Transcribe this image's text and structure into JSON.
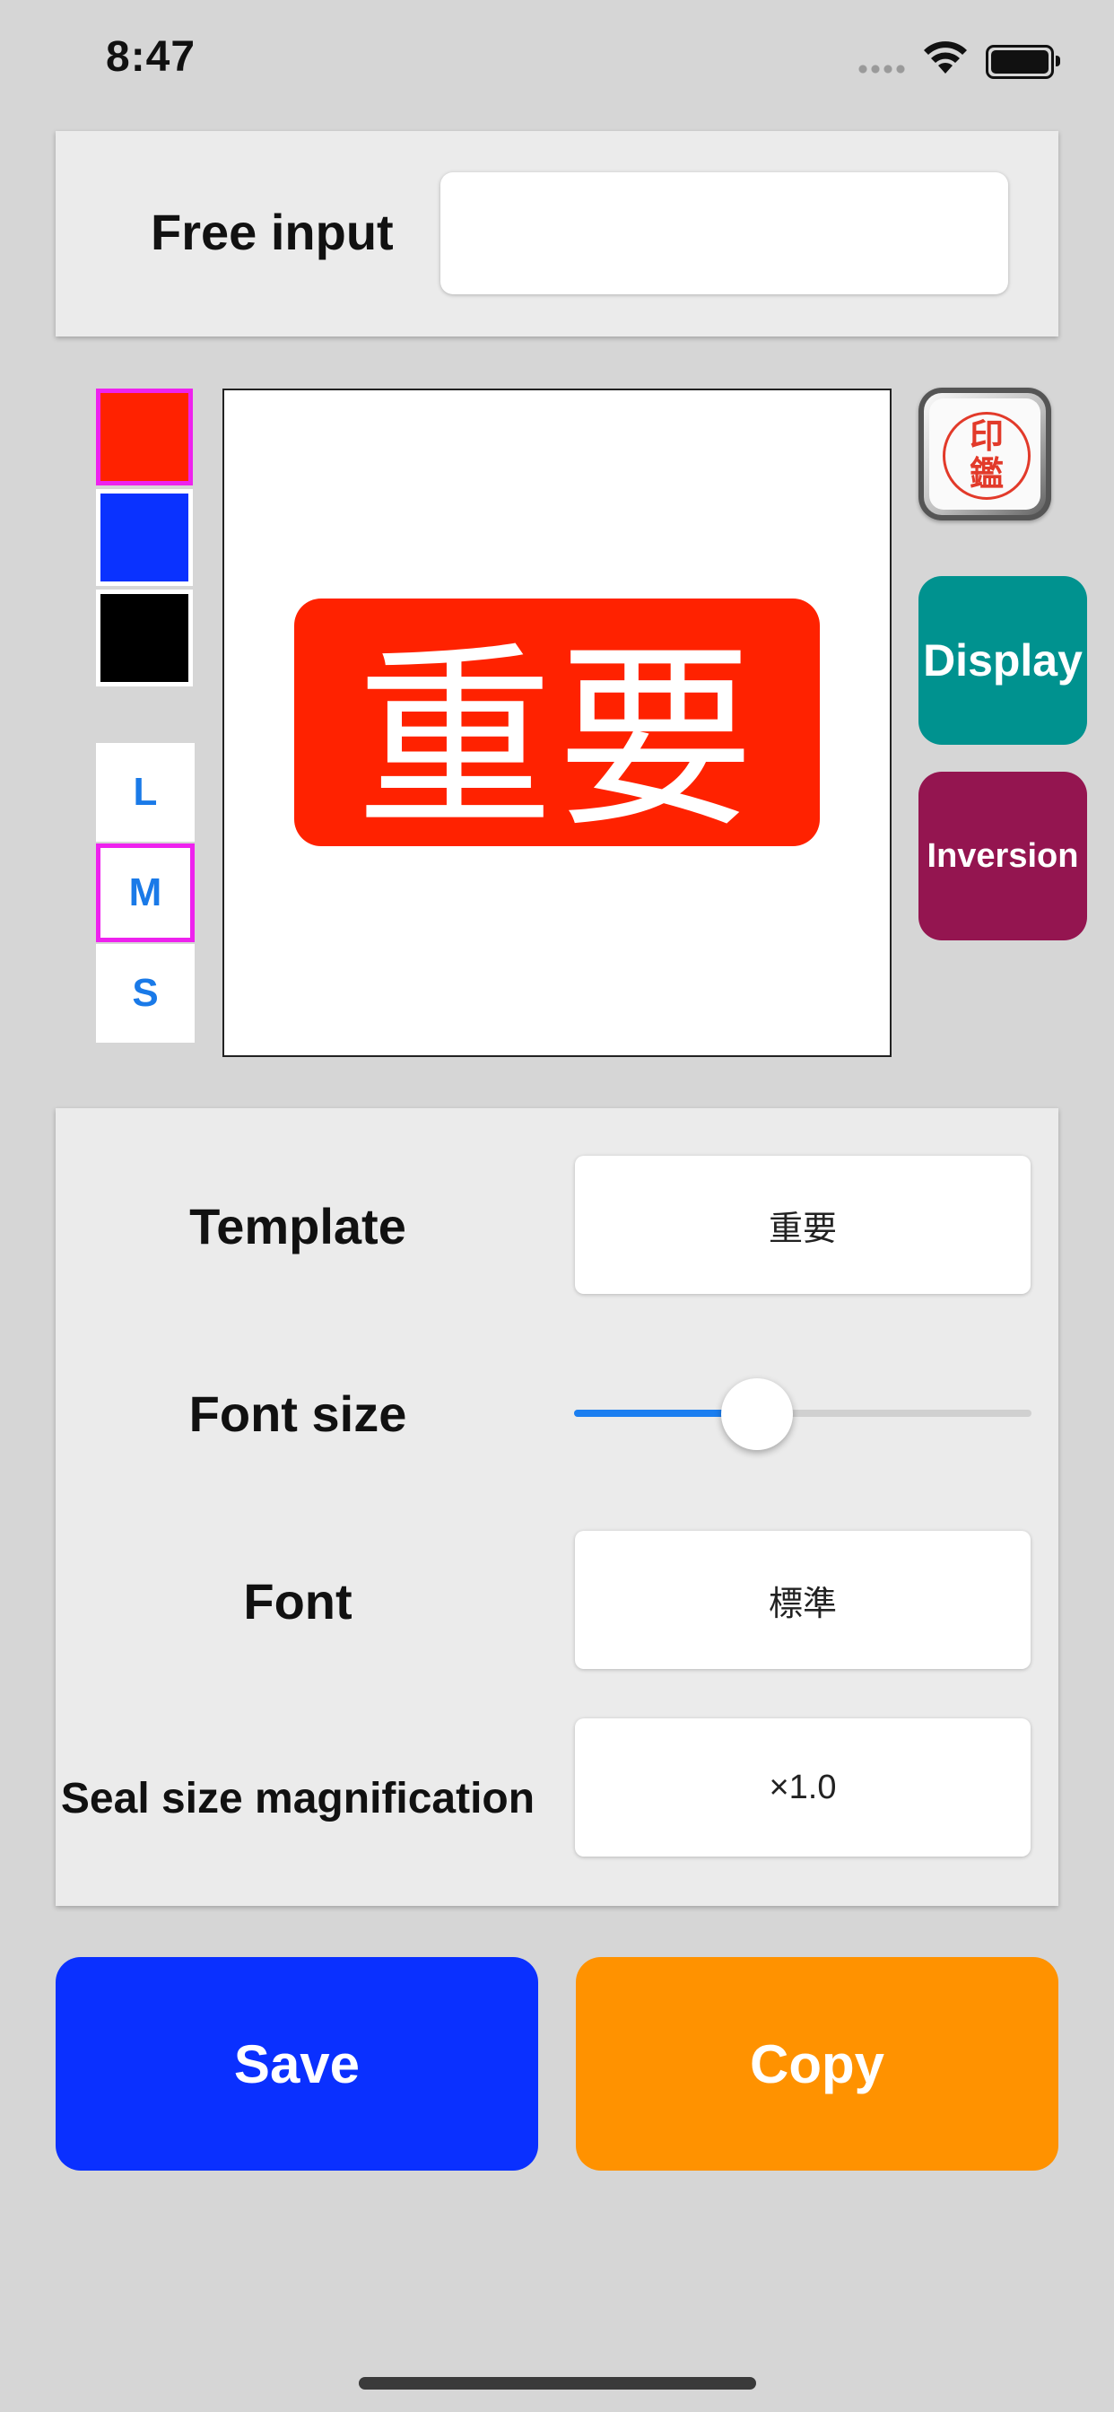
{
  "status_bar": {
    "time": "8:47"
  },
  "free_input": {
    "label": "Free input",
    "value": "",
    "placeholder": ""
  },
  "colors": {
    "swatches": [
      "#ff2200",
      "#0a32ff",
      "#000000"
    ],
    "selected_index": 0,
    "selection_outline": "#ee22ee"
  },
  "sizes": {
    "options": [
      "L",
      "M",
      "S"
    ],
    "selected": "M"
  },
  "preview": {
    "stamp_text": "重要",
    "stamp_color": "#ff2200",
    "text_color": "#ffffff"
  },
  "side_buttons": {
    "seal_icon": {
      "icon": "seal-stamp-icon",
      "text_top": "印",
      "text_bottom": "鑑"
    },
    "display": {
      "label": "Display",
      "color": "#00928f"
    },
    "inversion": {
      "label": "Inversion",
      "color": "#941550"
    }
  },
  "settings": {
    "template": {
      "label": "Template",
      "value": "重要"
    },
    "font_size": {
      "label": "Font size",
      "fraction": 0.4
    },
    "font": {
      "label": "Font",
      "value": "標準"
    },
    "seal_size": {
      "label": "Seal size magnification",
      "value": "×1.0"
    }
  },
  "actions": {
    "save": {
      "label": "Save",
      "color": "#0a30ff"
    },
    "copy": {
      "label": "Copy",
      "color": "#ff9200"
    }
  }
}
